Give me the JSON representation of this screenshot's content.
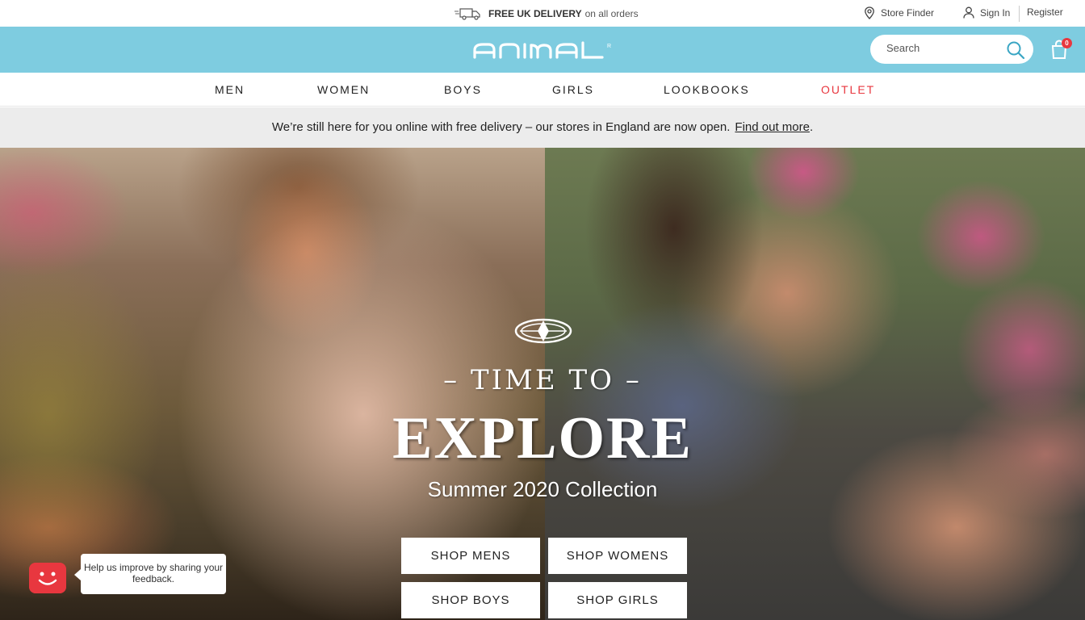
{
  "topbar": {
    "delivery_bold": "FREE UK DELIVERY",
    "delivery_rest": "on all orders",
    "store_finder": "Store Finder",
    "sign_in": "Sign In",
    "register": "Register"
  },
  "brand": {
    "logo_text": "animal",
    "search_placeholder": "Search",
    "bag_count": "0",
    "color": "#7ecce0"
  },
  "nav": {
    "items": [
      "MEN",
      "WOMEN",
      "BOYS",
      "GIRLS",
      "LOOKBOOKS",
      "OUTLET"
    ],
    "outlet_color": "#e8373f"
  },
  "notice": {
    "text": "We’re still here for you online with free delivery – our stores in England are now open.",
    "link": "Find out more",
    "link_suffix": "."
  },
  "hero": {
    "kicker": "– TIME TO –",
    "title": "EXPLORE",
    "subtitle": "Summer 2020 Collection",
    "buttons": [
      "SHOP MENS",
      "SHOP WOMENS",
      "SHOP BOYS",
      "SHOP GIRLS"
    ]
  },
  "feedback": {
    "text": "Help us improve by sharing your feedback."
  }
}
